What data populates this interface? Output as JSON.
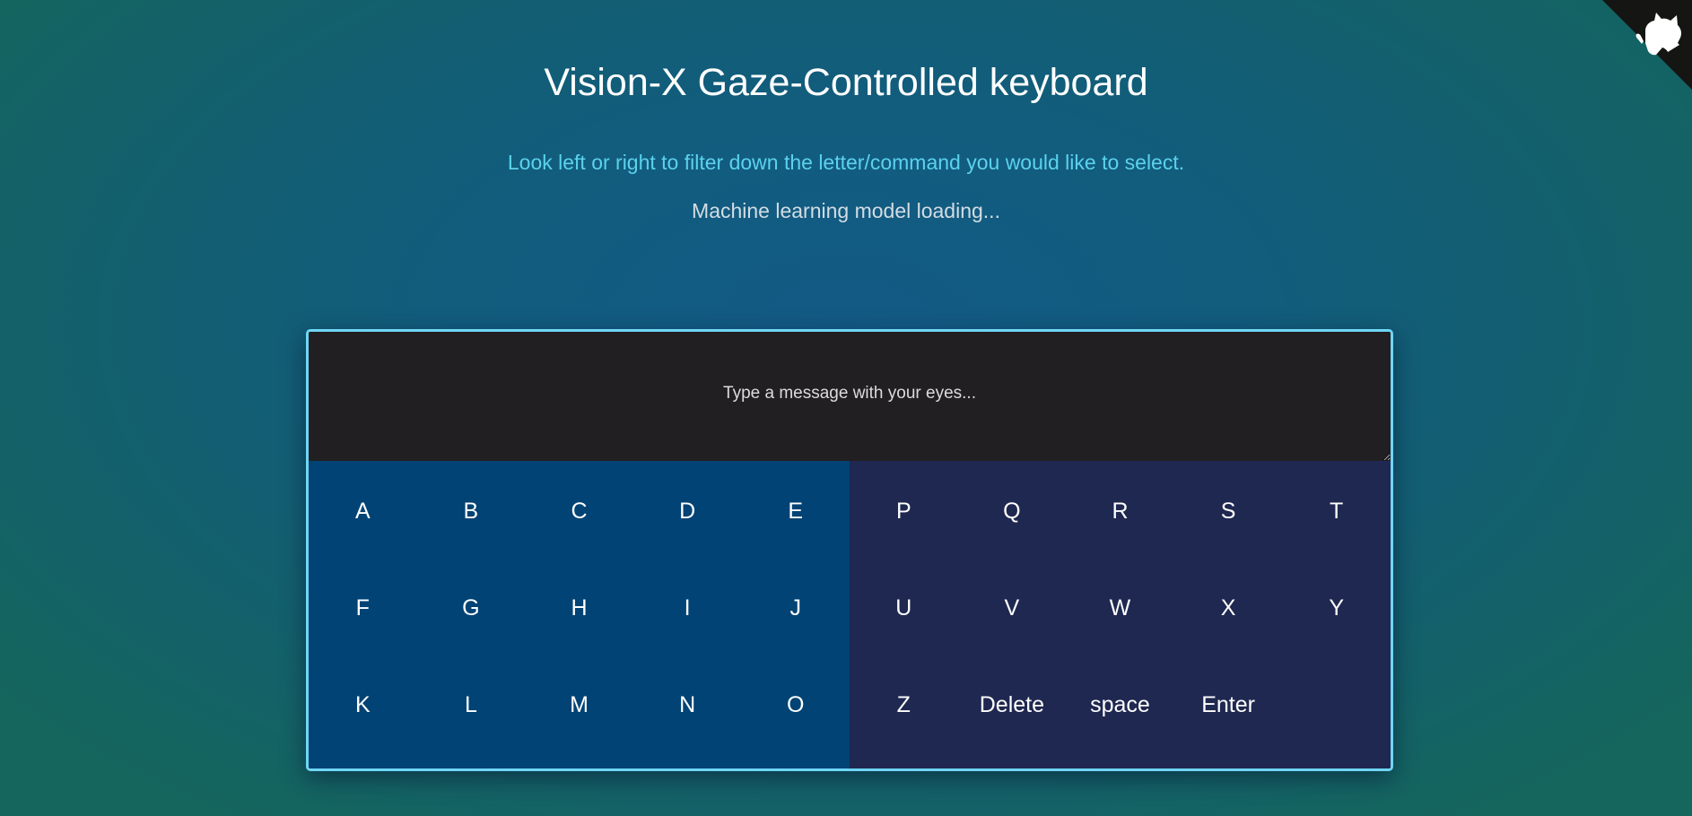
{
  "header": {
    "title": "Vision-X Gaze-Controlled keyboard",
    "instructions": "Look left or right to filter down the letter/command you would like to select.",
    "status": "Machine learning model loading..."
  },
  "message_box": {
    "placeholder": "Type a message with your eyes...",
    "value": ""
  },
  "keyboard": {
    "left_keys": [
      [
        "A",
        "B",
        "C",
        "D",
        "E"
      ],
      [
        "F",
        "G",
        "H",
        "I",
        "J"
      ],
      [
        "K",
        "L",
        "M",
        "N",
        "O"
      ]
    ],
    "right_keys": [
      [
        "P",
        "Q",
        "R",
        "S",
        "T"
      ],
      [
        "U",
        "V",
        "W",
        "X",
        "Y"
      ],
      [
        "Z",
        "Delete",
        "space",
        "Enter"
      ]
    ]
  },
  "corner_link": {
    "icon": "github-octocat-icon"
  },
  "colors": {
    "accent_border": "#6fd6f5",
    "instruction_text": "#5bd2ec",
    "left_half": "#014374",
    "right_half": "#1f2850",
    "message_background": "#211f21"
  }
}
